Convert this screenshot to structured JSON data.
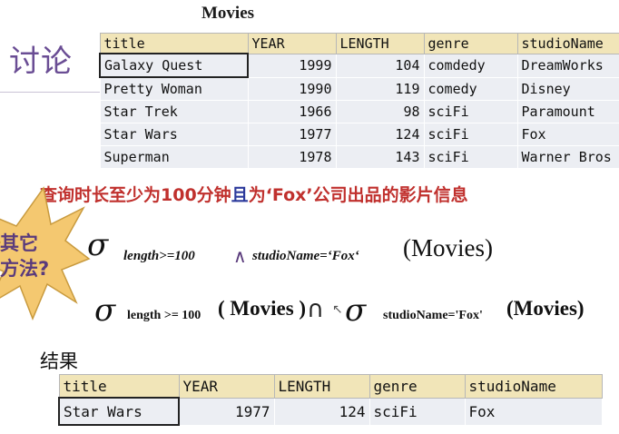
{
  "header": {
    "title": "Movies",
    "section_heading": "讨论"
  },
  "movies_table": {
    "columns": [
      "title",
      "YEAR",
      "LENGTH",
      "genre",
      "studioName"
    ],
    "rows": [
      [
        "Galaxy Quest",
        "1999",
        "104",
        "comdedy",
        "DreamWorks"
      ],
      [
        "Pretty Woman",
        "1990",
        "119",
        "comedy",
        "Disney"
      ],
      [
        "Star Trek",
        "1966",
        "98",
        "sciFi",
        "Paramount"
      ],
      [
        "Star Wars",
        "1977",
        "124",
        "sciFi",
        "Fox"
      ],
      [
        "Superman",
        "1978",
        "143",
        "sciFi",
        "Warner Bros"
      ]
    ]
  },
  "query": {
    "part1": "查询时长至少为100分钟",
    "conj": "且",
    "part2": "为‘Fox’公司出品的影片信息"
  },
  "callout": {
    "text": "其它\n方法?"
  },
  "formula1": {
    "sigma": "σ",
    "sub1": "length>=100",
    "and": "∧",
    "sub2": "studioName=‘Fox‘",
    "relation": "(Movies)"
  },
  "formula2": {
    "sigma": "σ",
    "sub1": "length >= 100",
    "relation1": "( Movies )",
    "cap": "∩",
    "sigma2": "σ",
    "sub2": "studioName='Fox'",
    "relation2": "(Movies)"
  },
  "result": {
    "label": "结果",
    "columns": [
      "title",
      "YEAR",
      "LENGTH",
      "genre",
      "studioName"
    ],
    "rows": [
      [
        "Star Wars",
        "1977",
        "124",
        "sciFi",
        "Fox"
      ]
    ]
  },
  "colors": {
    "header_bg": "#f1e5b8",
    "cell_bg": "#eceef3",
    "query_red": "#c0302d",
    "heading_purple": "#6a4d94",
    "starburst_fill": "#f4c870"
  }
}
